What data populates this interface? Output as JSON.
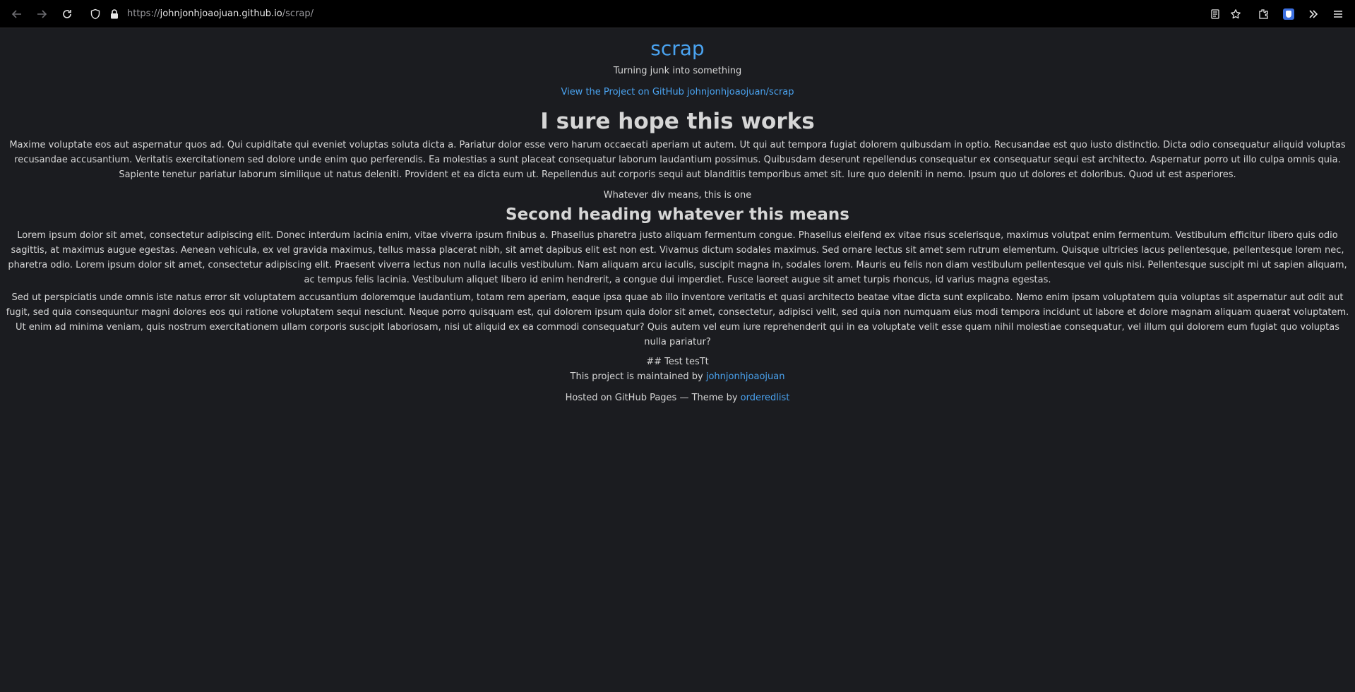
{
  "browser": {
    "url_protocol": "https://",
    "url_host": "johnjonhjoaojuan.github.io",
    "url_path": "/scrap/"
  },
  "site": {
    "title": "scrap",
    "tagline": "Turning junk into something",
    "github_link": "View the Project on GitHub johnjonhjoaojuan/scrap"
  },
  "content": {
    "heading1": "I sure hope this works",
    "paragraph1": "Maxime voluptate eos aut aspernatur quos ad. Qui cupiditate qui eveniet voluptas soluta dicta a. Pariatur dolor esse vero harum occaecati aperiam ut autem. Ut qui aut tempora fugiat dolorem quibusdam in optio. Recusandae est quo iusto distinctio. Dicta odio consequatur aliquid voluptas recusandae accusantium. Veritatis exercitationem sed dolore unde enim quo perferendis. Ea molestias a sunt placeat consequatur laborum laudantium possimus. Quibusdam deserunt repellendus consequatur ex consequatur sequi est architecto. Aspernatur porro ut illo culpa omnis quia. Sapiente tenetur pariatur laborum similique ut natus deleniti. Provident et ea dicta eum ut. Repellendus aut corporis sequi aut blanditiis temporibus amet sit. Iure quo deleniti in nemo. Ipsum quo ut dolores et doloribus. Quod ut est asperiores.",
    "div_text": "Whatever div means, this is one",
    "heading2": "Second heading whatever this means",
    "paragraph2": "Lorem ipsum dolor sit amet, consectetur adipiscing elit. Donec interdum lacinia enim, vitae viverra ipsum finibus a. Phasellus pharetra justo aliquam fermentum congue. Phasellus eleifend ex vitae risus scelerisque, maximus volutpat enim fermentum. Vestibulum efficitur libero quis odio sagittis, at maximus augue egestas. Aenean vehicula, ex vel gravida maximus, tellus massa placerat nibh, sit amet dapibus elit est non est. Vivamus dictum sodales maximus. Sed ornare lectus sit amet sem rutrum elementum. Quisque ultricies lacus pellentesque, pellentesque lorem nec, pharetra odio. Lorem ipsum dolor sit amet, consectetur adipiscing elit. Praesent viverra lectus non nulla iaculis vestibulum. Nam aliquam arcu iaculis, suscipit magna in, sodales lorem. Mauris eu felis non diam vestibulum pellentesque vel quis nisi. Pellentesque suscipit mi ut sapien aliquam, ac tempus felis lacinia. Vestibulum aliquet libero id enim hendrerit, a congue dui imperdiet. Fusce laoreet augue sit amet turpis rhoncus, id varius magna egestas.",
    "paragraph3": "Sed ut perspiciatis unde omnis iste natus error sit voluptatem accusantium doloremque laudantium, totam rem aperiam, eaque ipsa quae ab illo inventore veritatis et quasi architecto beatae vitae dicta sunt explicabo. Nemo enim ipsam voluptatem quia voluptas sit aspernatur aut odit aut fugit, sed quia consequuntur magni dolores eos qui ratione voluptatem sequi nesciunt. Neque porro quisquam est, qui dolorem ipsum quia dolor sit amet, consectetur, adipisci velit, sed quia non numquam eius modi tempora incidunt ut labore et dolore magnam aliquam quaerat voluptatem. Ut enim ad minima veniam, quis nostrum exercitationem ullam corporis suscipit laboriosam, nisi ut aliquid ex ea commodi consequatur? Quis autem vel eum iure reprehenderit qui in ea voluptate velit esse quam nihil molestiae consequatur, vel illum qui dolorem eum fugiat quo voluptas nulla pariatur?",
    "test_line": "## Test tesTt"
  },
  "footer": {
    "maintained_prefix": "This project is maintained by ",
    "maintainer": "johnjonhjoaojuan",
    "hosted_prefix": "Hosted on GitHub Pages — Theme by ",
    "theme_author": "orderedlist"
  },
  "colors": {
    "background": "#1b1c20",
    "link": "#4aa3f0",
    "text": "#d6d6d6"
  }
}
